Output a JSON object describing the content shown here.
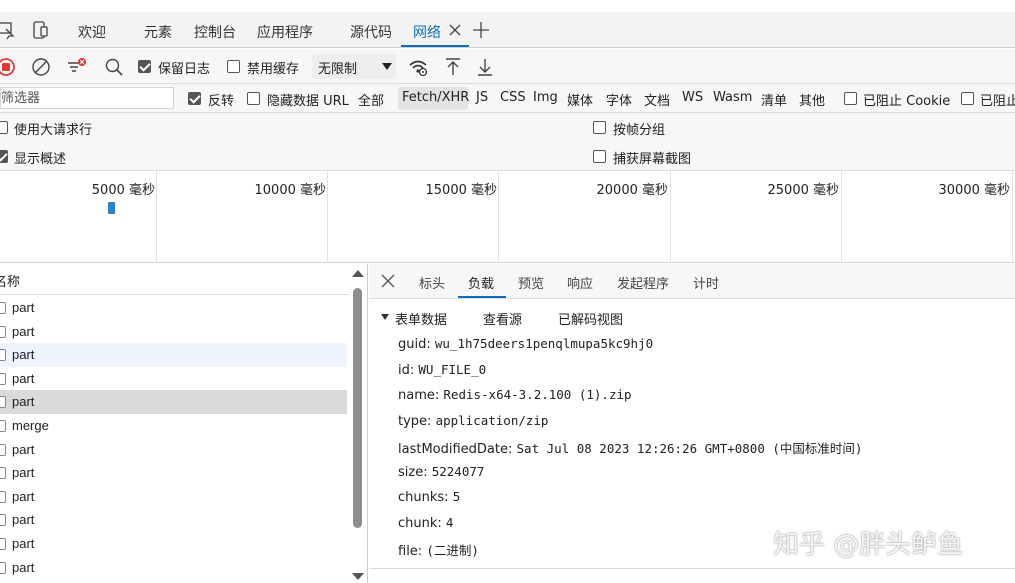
{
  "tabs": [
    {
      "label": "欢迎"
    },
    {
      "label": "元素"
    },
    {
      "label": "控制台"
    },
    {
      "label": "应用程序"
    },
    {
      "label": "源代码"
    },
    {
      "label": "网络"
    }
  ],
  "toolbar": {
    "preserve_log": "保留日志",
    "disable_cache": "禁用缓存",
    "throttling": "无限制"
  },
  "filter": {
    "placeholder": "筛选器",
    "invert": "反转",
    "hide_data_urls": "隐藏数据 URL",
    "types": [
      "全部",
      "Fetch/XHR",
      "JS",
      "CSS",
      "Img",
      "媒体",
      "字体",
      "文档",
      "WS",
      "Wasm",
      "清单",
      "其他"
    ],
    "blocked_cookies": "已阻止 Cookie",
    "blocked_requests": "已阻止"
  },
  "options": {
    "big_rows": "使用大请求行",
    "show_overview": "显示概述",
    "group_by_frame": "按帧分组",
    "capture_screenshots": "捕获屏幕截图"
  },
  "timeline": {
    "labels": [
      "5000 毫秒",
      "10000 毫秒",
      "15000 毫秒",
      "20000 毫秒",
      "25000 毫秒",
      "30000 毫秒"
    ]
  },
  "requests": {
    "header": "名称",
    "rows": [
      "part",
      "part",
      "part",
      "part",
      "part",
      "merge",
      "part",
      "part",
      "part",
      "part",
      "part",
      "part"
    ],
    "selected_index": 4,
    "hover_index": 2
  },
  "details": {
    "tabs": [
      "标头",
      "负载",
      "预览",
      "响应",
      "发起程序",
      "计时"
    ],
    "active_tab": "负载",
    "section_title": "表单数据",
    "view_source": "查看源",
    "view_decoded": "已解码视图",
    "fields": [
      {
        "key": "guid:",
        "value": "wu_1h75deers1penqlmupa5kc9hj0"
      },
      {
        "key": "id:",
        "value": "WU_FILE_0"
      },
      {
        "key": "name:",
        "value": "Redis-x64-3.2.100 (1).zip"
      },
      {
        "key": "type:",
        "value": "application/zip"
      },
      {
        "key": "lastModifiedDate:",
        "value": "Sat Jul 08 2023 12:26:26 GMT+0800 (中国标准时间)"
      },
      {
        "key": "size:",
        "value": "5224077"
      },
      {
        "key": "chunks:",
        "value": "5"
      },
      {
        "key": "chunk:",
        "value": "4"
      },
      {
        "key": "file:",
        "value": "(二进制)"
      }
    ]
  },
  "watermark": "知乎 @胖头鲈鱼",
  "colors": {
    "accent": "#0f6cbd",
    "record": "#e53935",
    "selected_row": "#dadada",
    "hover_row": "#eef4fc",
    "timeline_mark": "#2a7fd4"
  }
}
